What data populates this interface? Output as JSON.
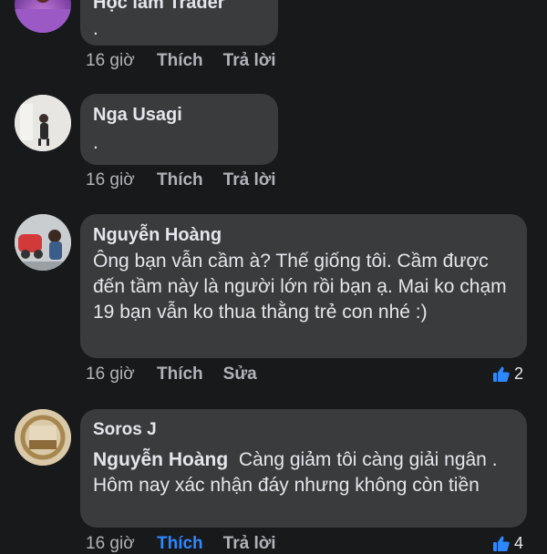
{
  "comments": [
    {
      "author": "Học lắm Trader",
      "text": ".",
      "time": "16 giờ",
      "like_label": "Thích",
      "reply_label": "Trả lời"
    },
    {
      "author": "Nga Usagi",
      "text": ".",
      "time": "16 giờ",
      "like_label": "Thích",
      "reply_label": "Trả lời"
    },
    {
      "author": "Nguyễn Hoàng",
      "text": "Ông bạn vẫn cầm à? Thế giống tôi. Cầm được đến tầm này là người lớn rồi bạn ạ. Mai ko chạm 19 bạn vẫn ko thua thằng trẻ con nhé :)",
      "time": "16 giờ",
      "like_label": "Thích",
      "edit_label": "Sửa",
      "reaction_count": "2"
    },
    {
      "author": "Soros J",
      "mention": "Nguyễn Hoàng",
      "text": "Càng giảm tôi càng giải ngân . Hôm nay xác nhận đáy nhưng không còn tiền",
      "time": "16 giờ",
      "like_label": "Thích",
      "reply_label": "Trả lời",
      "reaction_count": "4"
    }
  ],
  "colors": {
    "background": "#18191a",
    "bubble": "#3a3b3c",
    "secondary_text": "#b0b3b8",
    "like_active": "#2d88ff"
  }
}
